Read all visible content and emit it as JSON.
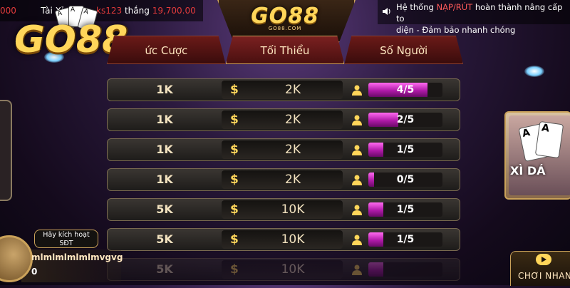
{
  "ticker": {
    "amount_left": "000",
    "game": "Tài Xỉ",
    "user": "ks123",
    "won_label": "thắng",
    "won_amount": "19,700.00"
  },
  "notice": {
    "prefix": "Hệ thống ",
    "highlight": "NẠP/RÚT",
    "suffix": " hoàn thành nâng cấp to",
    "line2": "diện - Đảm bảo nhanh chóng"
  },
  "crest": {
    "logo_text": "GO88",
    "domain": "GO88.COM"
  },
  "brand": {
    "logo_text": "GO88"
  },
  "tabs": [
    {
      "label": "ức Cược"
    },
    {
      "label": "Tối Thiểu"
    },
    {
      "label": "Số Người"
    }
  ],
  "rows": [
    {
      "bet": "1K",
      "currency": "$",
      "min": "2K",
      "players": "4/5",
      "fill": 0.8
    },
    {
      "bet": "1K",
      "currency": "$",
      "min": "2K",
      "players": "2/5",
      "fill": 0.4
    },
    {
      "bet": "1K",
      "currency": "$",
      "min": "2K",
      "players": "1/5",
      "fill": 0.2
    },
    {
      "bet": "1K",
      "currency": "$",
      "min": "2K",
      "players": "0/5",
      "fill": 0.08
    },
    {
      "bet": "5K",
      "currency": "$",
      "min": "10K",
      "players": "1/5",
      "fill": 0.2
    },
    {
      "bet": "5K",
      "currency": "$",
      "min": "10K",
      "players": "1/5",
      "fill": 0.2
    },
    {
      "bet": "5K",
      "currency": "$",
      "min": "10K",
      "players": "",
      "fill": 0.2
    }
  ],
  "side_card": {
    "label": "XÌ DÁ",
    "card1": "A",
    "card2": "A"
  },
  "profile": {
    "activate_line1": "Hãy kích hoạt",
    "activate_line2": "SĐT",
    "username": "mlmlmlmlmlmvgvg",
    "balance": "0"
  },
  "play": {
    "label": "CHƠI NHAN"
  },
  "colors": {
    "accent_gold": "#ffd65a",
    "fill_magenta": "#ff6af0",
    "tab_red": "#6a1a18"
  }
}
